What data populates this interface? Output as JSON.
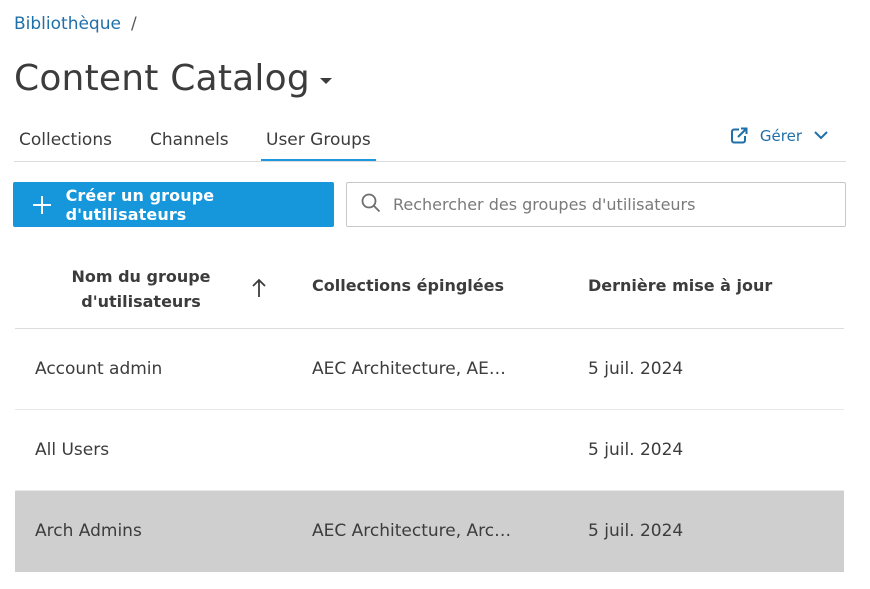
{
  "breadcrumb": {
    "root": "Bibliothèque",
    "separator": "/"
  },
  "page": {
    "title": "Content Catalog"
  },
  "tabs": [
    {
      "label": "Collections",
      "active": false
    },
    {
      "label": "Channels",
      "active": false
    },
    {
      "label": "User Groups",
      "active": true
    }
  ],
  "manage": {
    "label": "Gérer",
    "icon": "external-link-icon"
  },
  "actions": {
    "create_label": "Créer un groupe d'utilisateurs"
  },
  "search": {
    "placeholder": "Rechercher des groupes d'utilisateurs",
    "value": ""
  },
  "table": {
    "headers": {
      "name": "Nom du groupe d'utilisateurs",
      "pinned": "Collections épinglées",
      "updated": "Dernière mise à jour"
    },
    "sort": {
      "column": "name",
      "direction": "ascending"
    },
    "rows": [
      {
        "name": "Account admin",
        "pinned": "AEC Architecture, AEC ...",
        "updated": "5 juil. 2024",
        "selected": false
      },
      {
        "name": "All Users",
        "pinned": "",
        "updated": "5 juil. 2024",
        "selected": false
      },
      {
        "name": "Arch Admins",
        "pinned": "AEC Architecture, Archi...",
        "updated": "5 juil. 2024",
        "selected": true
      }
    ]
  },
  "colors": {
    "accent": "#1696db",
    "link": "#1f6fa8",
    "selected_row": "#cfcfcf"
  }
}
